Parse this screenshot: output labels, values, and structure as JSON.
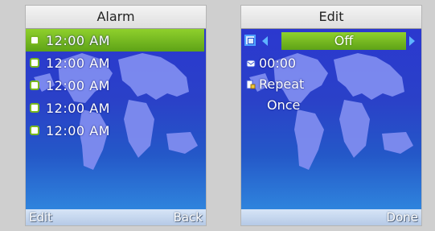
{
  "left": {
    "title": "Alarm",
    "alarms": [
      {
        "time": "12:00 AM"
      },
      {
        "time": "12:00 AM"
      },
      {
        "time": "12:00 AM"
      },
      {
        "time": "12:00 AM"
      },
      {
        "time": "12:00 AM"
      }
    ],
    "softkeys": {
      "left": "Edit",
      "right": "Back"
    }
  },
  "right": {
    "title": "Edit",
    "status_value": "Off",
    "time_value": "00:00",
    "repeat_label": "Repeat",
    "repeat_value": "Once",
    "softkeys": {
      "left": "",
      "right": "Done"
    }
  },
  "colors": {
    "accent_green": "#7cc322",
    "background_blue": "#2c3fc2",
    "map": "#7f8cf0"
  }
}
